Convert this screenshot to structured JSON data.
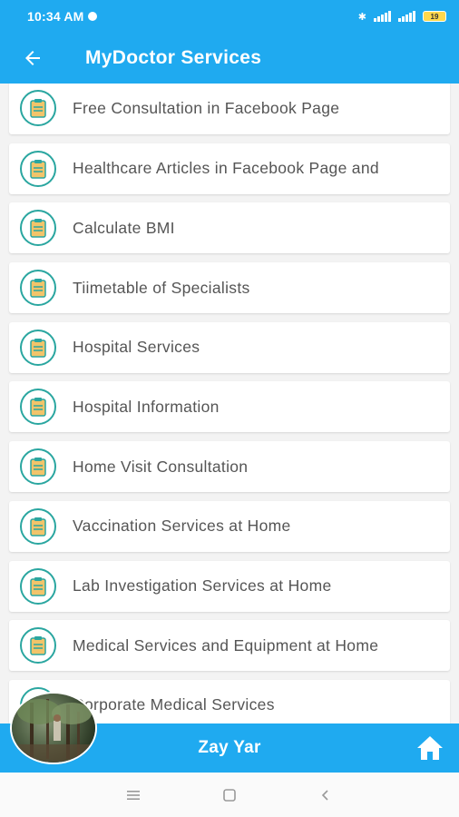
{
  "status_bar": {
    "time": "10:34 AM",
    "battery": "19"
  },
  "app_bar": {
    "title": "MyDoctor Services"
  },
  "services": [
    {
      "label": "Free Consultation in Facebook Page"
    },
    {
      "label": "Healthcare Articles in Facebook Page and"
    },
    {
      "label": "Calculate BMI"
    },
    {
      "label": "Tiimetable of Specialists"
    },
    {
      "label": "Hospital Services"
    },
    {
      "label": "Hospital Information"
    },
    {
      "label": "Home Visit Consultation"
    },
    {
      "label": "Vaccination Services at Home"
    },
    {
      "label": "Lab Investigation Services at Home"
    },
    {
      "label": "Medical Services and Equipment at Home"
    },
    {
      "label": "Corporate Medical Services"
    }
  ],
  "bottom_bar": {
    "user_name": "Zay Yar"
  },
  "icons": {
    "back": "arrow-left-icon",
    "service": "clipboard-icon",
    "home": "home-icon"
  },
  "colors": {
    "primary": "#1faaf0",
    "icon_ring": "#2aa6a0",
    "icon_fill": "#f2b13a",
    "text": "#555555"
  }
}
